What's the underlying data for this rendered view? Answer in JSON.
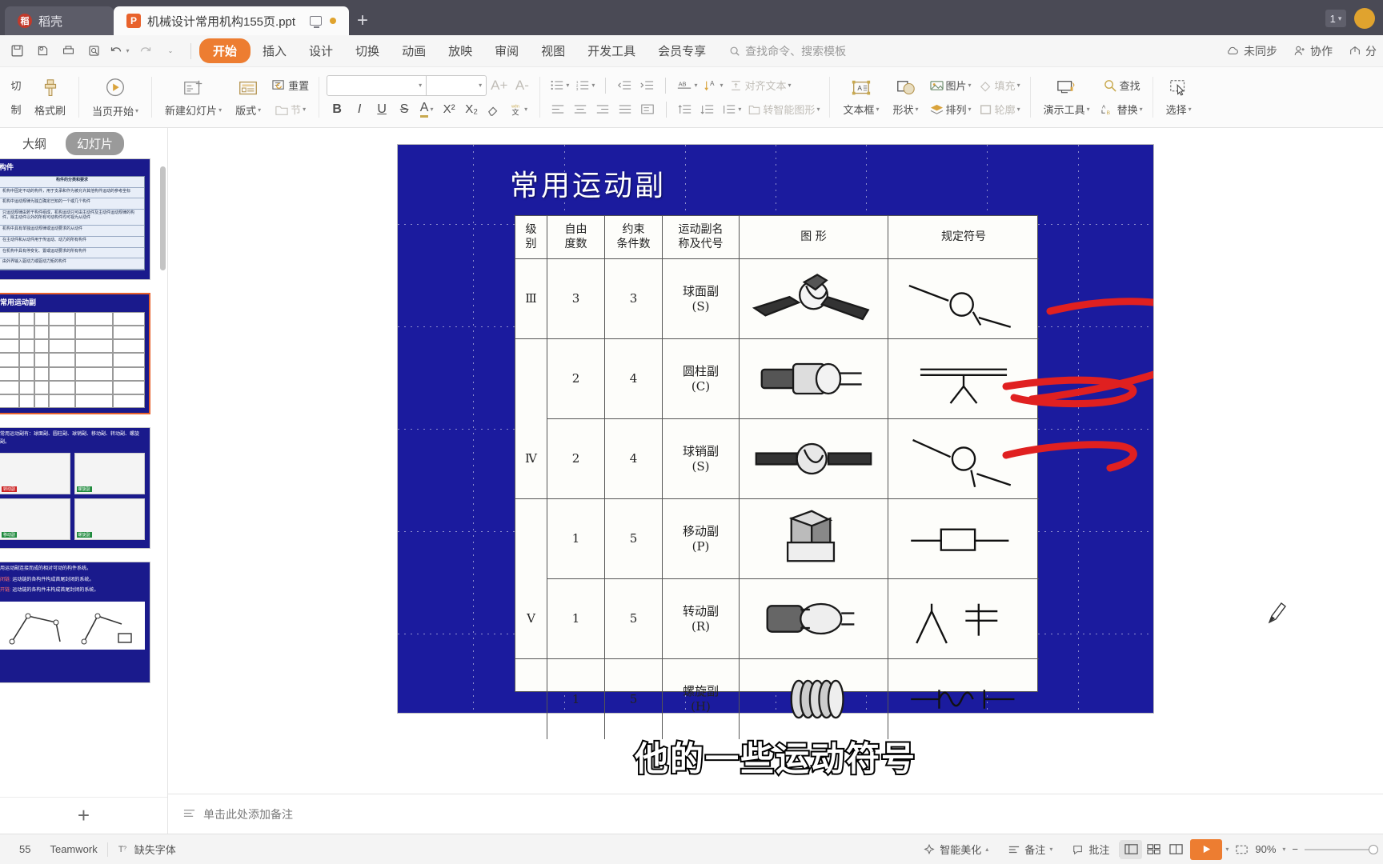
{
  "titlebar": {
    "tabs": [
      {
        "label": "稻壳",
        "icon": "docer-icon",
        "active": false
      },
      {
        "label": "机械设计常用机构155页.ppt",
        "icon": "ppt-icon",
        "active": true
      }
    ],
    "new_tab_label": "+",
    "window_chip": "1",
    "avatar": "user-avatar"
  },
  "menubar": {
    "quick_access": [
      "save-icon",
      "print-preview-icon",
      "print-icon",
      "search-doc-icon",
      "undo-icon",
      "redo-icon",
      "customize-icon"
    ],
    "items": [
      "开始",
      "插入",
      "设计",
      "切换",
      "动画",
      "放映",
      "审阅",
      "视图",
      "开发工具",
      "会员专享"
    ],
    "active_item": "开始",
    "search_placeholder": "查找命令、搜索模板",
    "right_items": [
      {
        "label": "未同步",
        "icon": "cloud-sync-icon"
      },
      {
        "label": "协作",
        "icon": "collaborate-icon"
      },
      {
        "label": "分",
        "icon": "share-icon"
      }
    ]
  },
  "ribbon": {
    "clipboard": {
      "cut_partial": "切",
      "copy_partial": "制",
      "format_painter": "格式刷"
    },
    "slideshow": {
      "start_here": "当页开始"
    },
    "slides": {
      "new_slide": "新建幻灯片",
      "layout": "版式",
      "reset": "重置",
      "section": "节"
    },
    "font": {
      "name_value": "",
      "size_value": "",
      "grow": "A+",
      "shrink": "A-",
      "bold": "B",
      "italic": "I",
      "underline": "U",
      "strike": "S",
      "font_color": "A",
      "superscript": "X²",
      "subscript": "X₂",
      "clear_format": "clear-format-icon",
      "phonetic": "拼音指南"
    },
    "paragraph": {
      "align_text": "对齐文本",
      "to_smartart": "转智能图形"
    },
    "insert": {
      "textbox": "文本框",
      "shape": "形状",
      "picture": "图片",
      "arrange": "排列",
      "fill": "填充",
      "outline": "轮廓"
    },
    "tools": {
      "present_tools": "演示工具",
      "find": "查找",
      "replace": "替换",
      "select": "选择"
    }
  },
  "sidebar": {
    "tabs": [
      {
        "label": "大纲",
        "active": false
      },
      {
        "label": "幻灯片",
        "active": true
      }
    ],
    "thumbnails": [
      {
        "title": "构件",
        "selected": false,
        "rows": [
          "构件的分类和要求",
          "机构中固定不动的构件，用于支承和作为被允许其他构件运动的参考坐标",
          "机构中运动规律为独立确定已知的一个或几个构件",
          "只运动规律由若干构件组成，机构运动只可由主动件及主动件运动规律的构件，除主动件以外的所有可动构件均可视为从动件",
          "机构中具有单独运动规律或运动要求的从动件",
          "在主动件和从动件用于传运动、动力的所有构件",
          "在机构中具有停变化、置或运动要求的所有构件",
          "由外界输入驱动力或驱动力矩的构件"
        ]
      },
      {
        "title": "常用运动副",
        "selected": true
      },
      {
        "title": "",
        "selected": false,
        "caption_text": "常用运动副有：球面副、圆柱副、球销副、移动副、转动副、螺旋副。",
        "image_captions": [
          "转动副",
          "螺旋副",
          "移动副",
          "螺旋副"
        ]
      },
      {
        "title": "",
        "selected": false,
        "lines": [
          "用运动副连接而成的相对可动的构件系统。",
          "运动链的各构件构成首尾封闭的系统。",
          "运动链的各构件未构成首尾封闭的系统。"
        ],
        "labels": [
          "闭链:",
          "开链:"
        ]
      }
    ],
    "add_slide": "+"
  },
  "slide": {
    "title": "常用运动副",
    "table": {
      "headers": [
        "级别",
        "自由度数",
        "约束条件数",
        "运动副名称及代号",
        "图  形",
        "规定符号"
      ],
      "header_lines": [
        [
          "级",
          "别"
        ],
        [
          "自由",
          "度数"
        ],
        [
          "约束",
          "条件数"
        ],
        [
          "运动副名",
          "称及代号"
        ],
        [
          "图    形"
        ],
        [
          "规定符号"
        ]
      ],
      "rows": [
        {
          "class": "Ⅲ",
          "dof": "3",
          "constraints": "3",
          "name": "球面副",
          "code": "(S)",
          "figure": "spherical-joint-figure",
          "symbol": "spherical-joint-symbol"
        },
        {
          "class": "Ⅳ",
          "dof": "2",
          "constraints": "4",
          "name": "圆柱副",
          "code": "(C)",
          "figure": "cylindrical-joint-figure",
          "symbol": "cylindrical-joint-symbol"
        },
        {
          "class": "",
          "dof": "2",
          "constraints": "4",
          "name": "球销副",
          "code": "(S)",
          "figure": "ball-pin-joint-figure",
          "symbol": "ball-pin-joint-symbol"
        },
        {
          "class": "Ⅴ",
          "dof": "1",
          "constraints": "5",
          "name": "移动副",
          "code": "(P)",
          "figure": "prismatic-joint-figure",
          "symbol": "prismatic-joint-symbol"
        },
        {
          "class": "",
          "dof": "1",
          "constraints": "5",
          "name": "转动副",
          "code": "(R)",
          "figure": "revolute-joint-figure",
          "symbol": "revolute-joint-symbol"
        },
        {
          "class": "",
          "dof": "1",
          "constraints": "5",
          "name": "螺旋副",
          "code": "(H)",
          "figure": "helical-joint-figure",
          "symbol": "helical-joint-symbol"
        }
      ]
    },
    "annotation_color": "#e02020"
  },
  "subtitle": "他的一些运动符号",
  "notes": {
    "placeholder": "单击此处添加备注"
  },
  "status": {
    "page_info": "55",
    "teamwork": "Teamwork",
    "missing_font": "缺失字体",
    "beautify": "智能美化",
    "notes_btn": "备注",
    "comment_btn": "批注",
    "zoom": "90%",
    "zoom_out": "−",
    "views": [
      "normal-view",
      "sorter-view",
      "reading-view"
    ],
    "active_view": "normal-view"
  }
}
